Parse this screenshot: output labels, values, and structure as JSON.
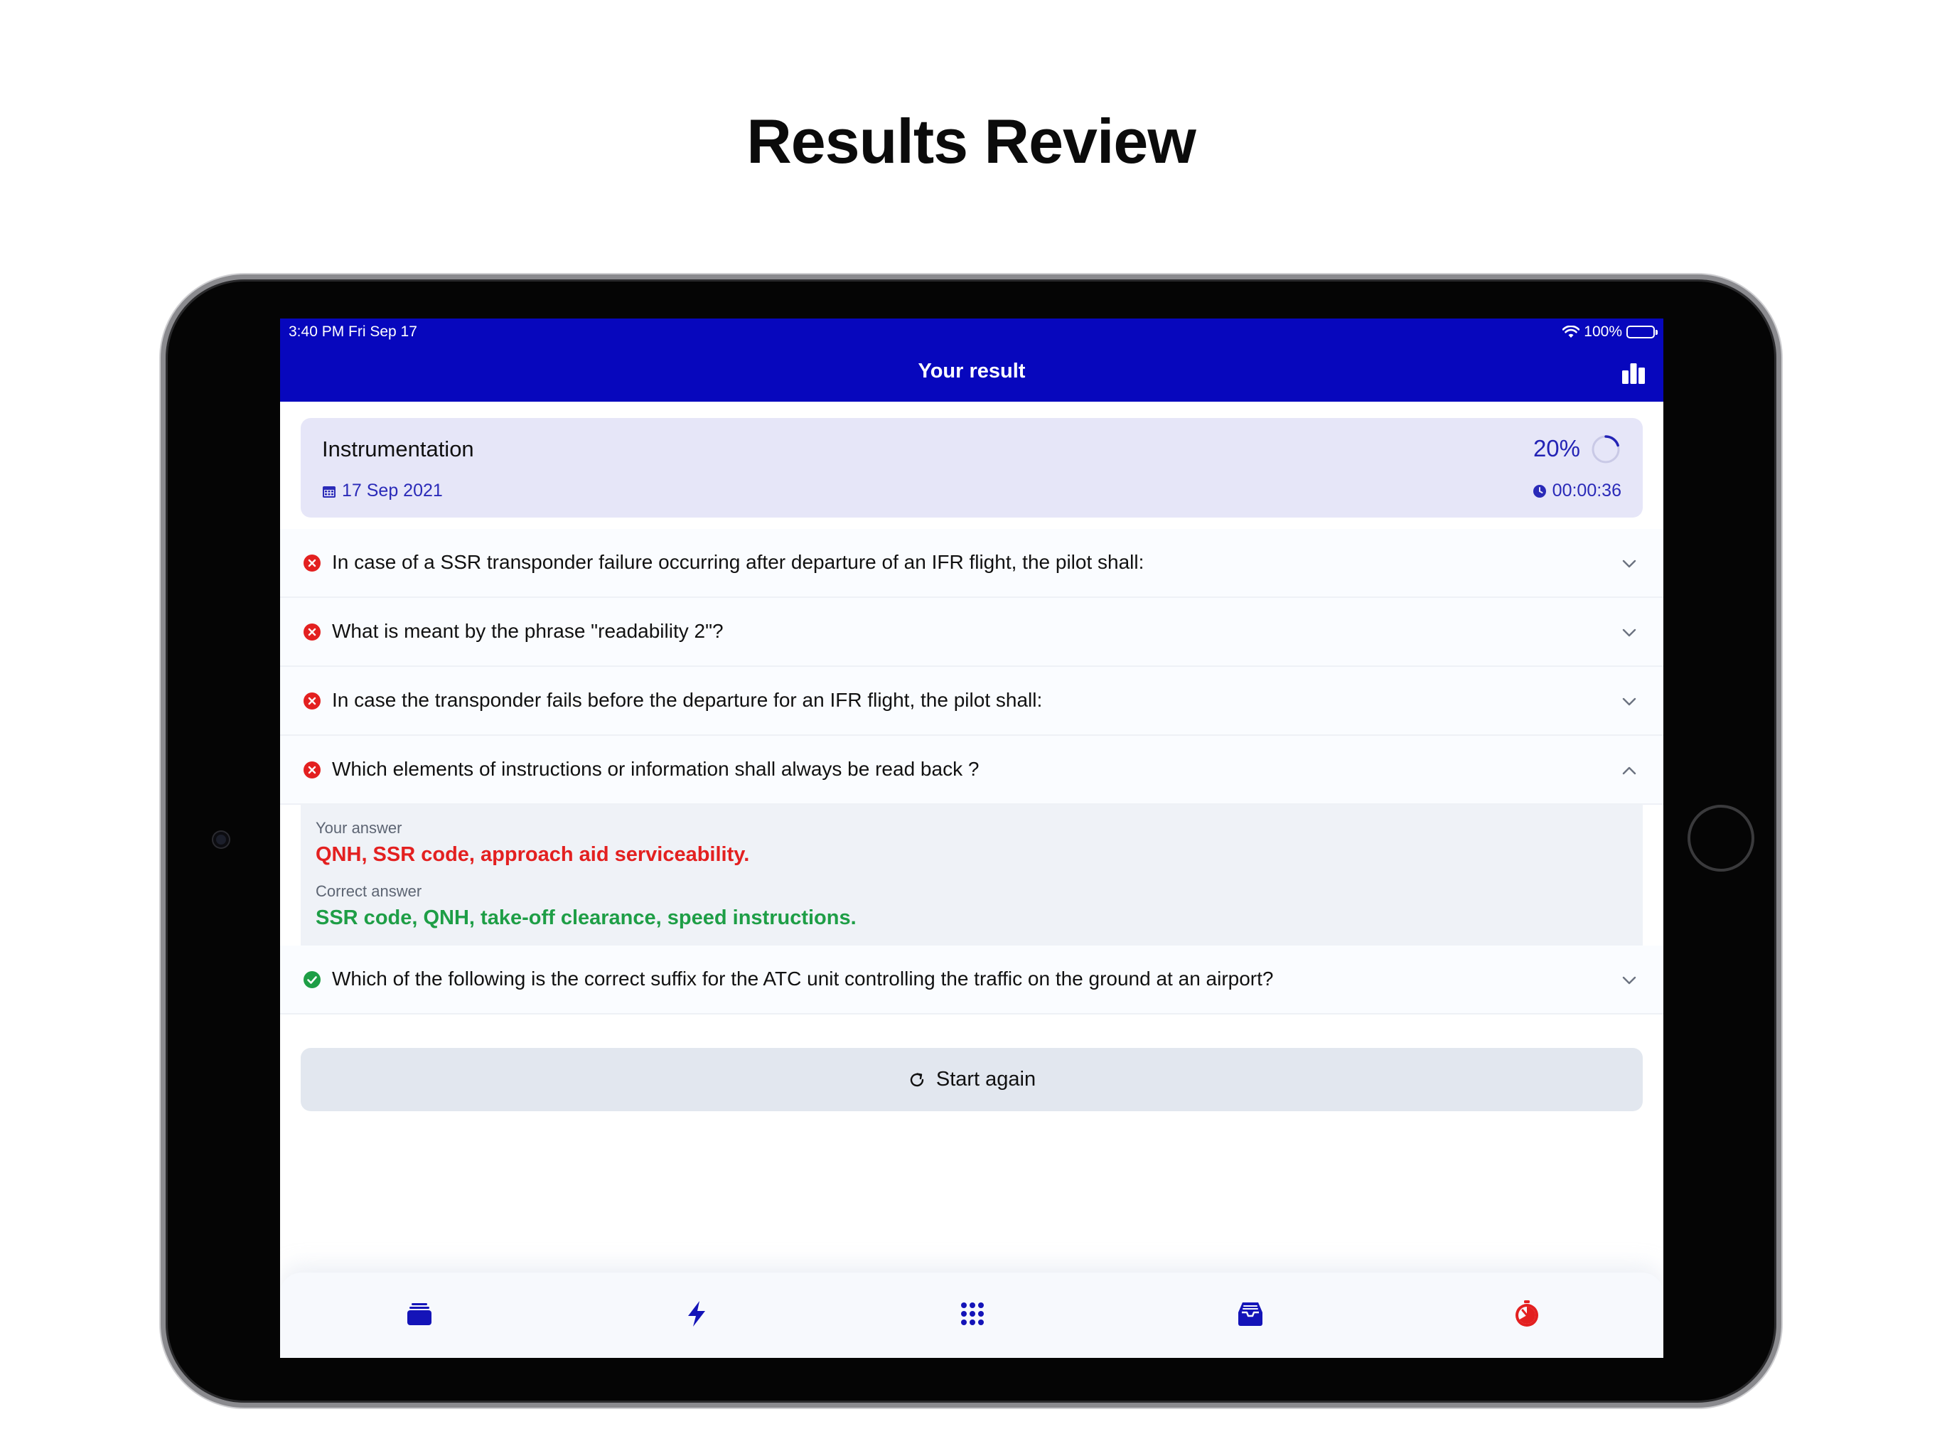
{
  "headline": "Results Review",
  "status_bar": {
    "time": "3:40 PM   Fri Sep 17",
    "battery": "100%"
  },
  "nav": {
    "title": "Your result",
    "stats_icon": "bar-chart-icon"
  },
  "summary": {
    "subject": "Instrumentation",
    "date": "17 Sep 2021",
    "score_percent": "20%",
    "score_value": 0.2,
    "duration": "00:00:36"
  },
  "questions": [
    {
      "text": "In case of a SSR transponder failure occurring after departure of an IFR flight, the pilot shall:",
      "correct": false,
      "expanded": false
    },
    {
      "text": "What is meant by the phrase \"readability 2\"?",
      "correct": false,
      "expanded": false
    },
    {
      "text": "In case the transponder fails before the departure for an IFR flight, the pilot shall:",
      "correct": false,
      "expanded": false
    },
    {
      "text": "Which elements of instructions or information shall always be read back ?",
      "correct": false,
      "expanded": true
    },
    {
      "text": "Which of the following is the correct suffix for the ATC unit controlling the traffic on the ground at an airport?",
      "correct": true,
      "expanded": false
    }
  ],
  "answer_panel": {
    "your_answer_label": "Your answer",
    "your_answer": "QNH, SSR code, approach aid serviceability.",
    "correct_answer_label": "Correct answer",
    "correct_answer": "SSR code, QNH, take-off clearance, speed instructions."
  },
  "restart_label": "Start again",
  "tabs": [
    "cards-icon",
    "lightning-icon",
    "grid-icon",
    "inbox-icon",
    "timer-icon"
  ],
  "colors": {
    "header": "#0707bd",
    "wrong": "#e32020",
    "right": "#1e9e46",
    "accent": "#2323b5",
    "timer_tab": "#e32020"
  }
}
